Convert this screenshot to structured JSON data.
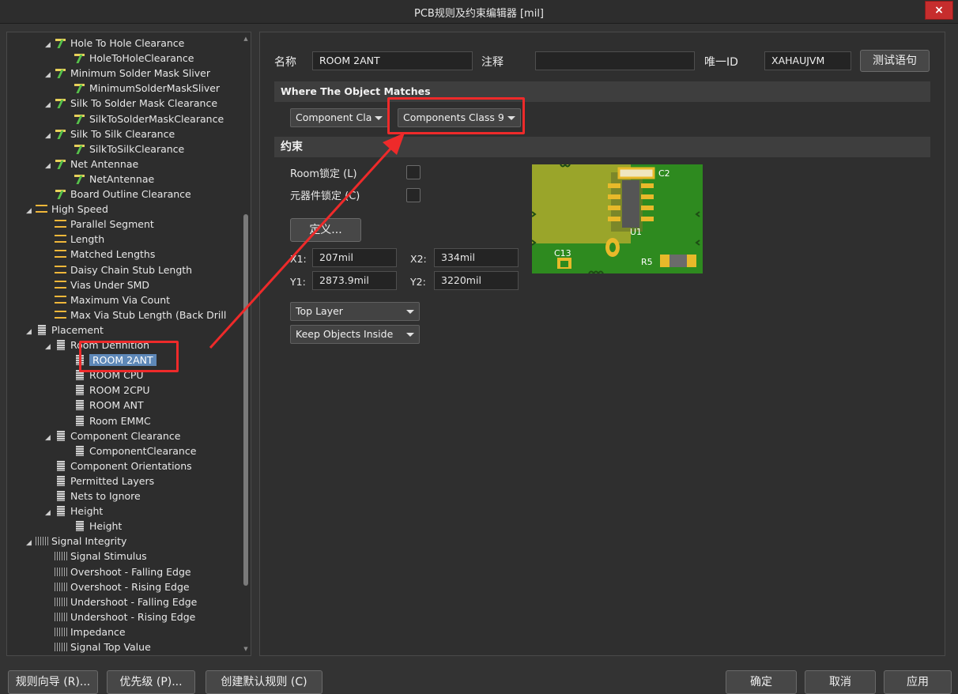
{
  "window": {
    "title": "PCB规则及约束编辑器 [mil]",
    "close_label": "×"
  },
  "tree": {
    "items": [
      {
        "label": "Hole To Hole Clearance",
        "indent": 2,
        "icon": "rule",
        "arrow": "◢"
      },
      {
        "label": "HoleToHoleClearance",
        "indent": 3,
        "icon": "rule",
        "arrow": ""
      },
      {
        "label": "Minimum Solder Mask Sliver",
        "indent": 2,
        "icon": "rule",
        "arrow": "◢"
      },
      {
        "label": "MinimumSolderMaskSliver",
        "indent": 3,
        "icon": "rule",
        "arrow": ""
      },
      {
        "label": "Silk To Solder Mask Clearance",
        "indent": 2,
        "icon": "rule",
        "arrow": "◢"
      },
      {
        "label": "SilkToSolderMaskClearance",
        "indent": 3,
        "icon": "rule",
        "arrow": ""
      },
      {
        "label": "Silk To Silk Clearance",
        "indent": 2,
        "icon": "rule",
        "arrow": "◢"
      },
      {
        "label": "SilkToSilkClearance",
        "indent": 3,
        "icon": "rule",
        "arrow": ""
      },
      {
        "label": "Net Antennae",
        "indent": 2,
        "icon": "rule",
        "arrow": "◢"
      },
      {
        "label": "NetAntennae",
        "indent": 3,
        "icon": "rule",
        "arrow": ""
      },
      {
        "label": "Board Outline Clearance",
        "indent": 2,
        "icon": "rule",
        "arrow": ""
      },
      {
        "label": "High Speed",
        "indent": 1,
        "icon": "hs",
        "arrow": "◢"
      },
      {
        "label": "Parallel Segment",
        "indent": 2,
        "icon": "hs",
        "arrow": ""
      },
      {
        "label": "Length",
        "indent": 2,
        "icon": "hs",
        "arrow": ""
      },
      {
        "label": "Matched Lengths",
        "indent": 2,
        "icon": "hs",
        "arrow": ""
      },
      {
        "label": "Daisy Chain Stub Length",
        "indent": 2,
        "icon": "hs",
        "arrow": ""
      },
      {
        "label": "Vias Under SMD",
        "indent": 2,
        "icon": "hs",
        "arrow": ""
      },
      {
        "label": "Maximum Via Count",
        "indent": 2,
        "icon": "hs",
        "arrow": ""
      },
      {
        "label": "Max Via Stub Length (Back Drill",
        "indent": 2,
        "icon": "hs",
        "arrow": ""
      },
      {
        "label": "Placement",
        "indent": 1,
        "icon": "chip",
        "arrow": "◢"
      },
      {
        "label": "Room Definition",
        "indent": 2,
        "icon": "chip",
        "arrow": "◢"
      },
      {
        "label": "ROOM 2ANT",
        "indent": 3,
        "icon": "chip",
        "arrow": "",
        "selected": true
      },
      {
        "label": "ROOM CPU",
        "indent": 3,
        "icon": "chip",
        "arrow": ""
      },
      {
        "label": "ROOM 2CPU",
        "indent": 3,
        "icon": "chip",
        "arrow": ""
      },
      {
        "label": "ROOM ANT",
        "indent": 3,
        "icon": "chip",
        "arrow": ""
      },
      {
        "label": "Room EMMC",
        "indent": 3,
        "icon": "chip",
        "arrow": ""
      },
      {
        "label": "Component Clearance",
        "indent": 2,
        "icon": "chip",
        "arrow": "◢"
      },
      {
        "label": "ComponentClearance",
        "indent": 3,
        "icon": "chip",
        "arrow": ""
      },
      {
        "label": "Component Orientations",
        "indent": 2,
        "icon": "chip",
        "arrow": ""
      },
      {
        "label": "Permitted Layers",
        "indent": 2,
        "icon": "chip",
        "arrow": ""
      },
      {
        "label": "Nets to Ignore",
        "indent": 2,
        "icon": "chip",
        "arrow": ""
      },
      {
        "label": "Height",
        "indent": 2,
        "icon": "chip",
        "arrow": "◢"
      },
      {
        "label": "Height",
        "indent": 3,
        "icon": "chip",
        "arrow": ""
      },
      {
        "label": "Signal Integrity",
        "indent": 1,
        "icon": "si",
        "arrow": "◢"
      },
      {
        "label": "Signal Stimulus",
        "indent": 2,
        "icon": "si",
        "arrow": ""
      },
      {
        "label": "Overshoot - Falling Edge",
        "indent": 2,
        "icon": "si",
        "arrow": ""
      },
      {
        "label": "Overshoot - Rising Edge",
        "indent": 2,
        "icon": "si",
        "arrow": ""
      },
      {
        "label": "Undershoot - Falling Edge",
        "indent": 2,
        "icon": "si",
        "arrow": ""
      },
      {
        "label": "Undershoot - Rising Edge",
        "indent": 2,
        "icon": "si",
        "arrow": ""
      },
      {
        "label": "Impedance",
        "indent": 2,
        "icon": "si",
        "arrow": ""
      },
      {
        "label": "Signal Top Value",
        "indent": 2,
        "icon": "si",
        "arrow": ""
      }
    ]
  },
  "rule": {
    "name_label": "名称",
    "name_value": "ROOM 2ANT",
    "comment_label": "注释",
    "comment_value": "",
    "uid_label": "唯一ID",
    "uid_value": "XAHAUJVM",
    "test_button": "测试语句"
  },
  "match": {
    "section_title": "Where The Object Matches",
    "type_dropdown": "Component Cla",
    "class_dropdown": "Components Class 9"
  },
  "constraints": {
    "section_title": "约束",
    "room_lock_label": "Room锁定 (L)",
    "component_lock_label": "元器件锁定 (C)",
    "define_button": "定义...",
    "x1_label": "X1:",
    "x1_value": "207mil",
    "x2_label": "X2:",
    "x2_value": "334mil",
    "y1_label": "Y1:",
    "y1_value": "2873.9mil",
    "y2_label": "Y2:",
    "y2_value": "3220mil",
    "layer_dropdown": "Top Layer",
    "keep_dropdown": "Keep Objects Inside",
    "preview_labels": {
      "c2": "C2",
      "u1": "U1",
      "c13": "C13",
      "r5": "R5"
    }
  },
  "footer": {
    "wizard_button": "规则向导 (R)...",
    "priority_button": "优先级 (P)...",
    "default_button": "创建默认规则 (C)",
    "ok_button": "确定",
    "cancel_button": "取消",
    "apply_button": "应用"
  },
  "colors": {
    "selection": "#5e88b8",
    "highlight_box": "#ee2a2a",
    "board_green": "#2e8a1f",
    "board_yellow": "#9aa52a",
    "pad_gold": "#e8b92a"
  }
}
